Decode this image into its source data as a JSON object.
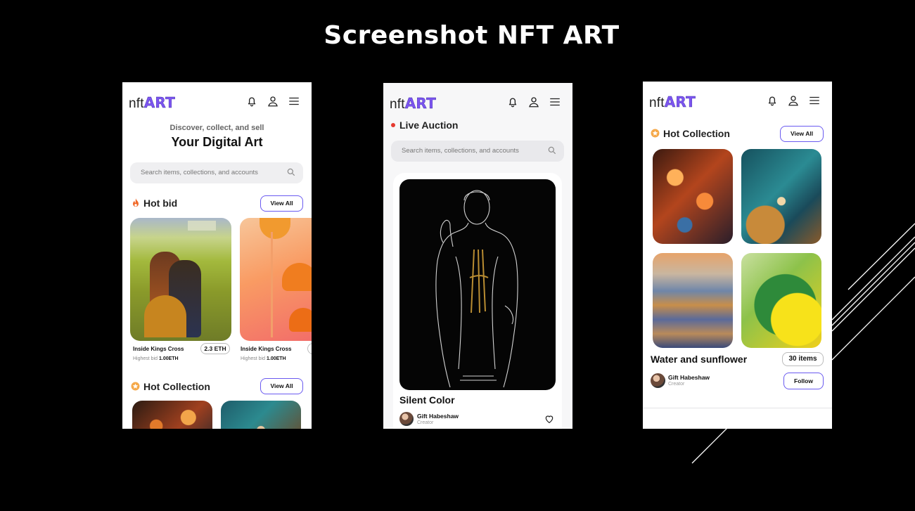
{
  "slide": {
    "title": "Screenshot NFT ART"
  },
  "brand": {
    "logo_prefix": "nft",
    "logo_accent": "ART",
    "accent_color": "#7d55f0",
    "outline_color": "#6a5af0"
  },
  "icons": {
    "bell": "bell-icon",
    "user": "user-icon",
    "menu": "menu-icon",
    "search": "search-icon",
    "fire": "fire-icon",
    "star": "star-badge-icon",
    "heart": "heart-icon"
  },
  "home": {
    "eyebrow": "Discover, collect, and sell",
    "title": "Your Digital Art",
    "search_placeholder": "Search items, collections, and accounts",
    "hot_bid": {
      "title": "Hot bid",
      "view_all": "View All",
      "cards": [
        {
          "name": "Inside Kings Cross",
          "price": "2.3 ETH",
          "bid_label": "Highest bid",
          "bid_value": "1.00ETH"
        },
        {
          "name": "Inside Kings Cross",
          "bid_label": "Highest bid",
          "bid_value": "1.00ETH"
        }
      ]
    },
    "hot_collection": {
      "title": "Hot Collection",
      "view_all": "View All"
    }
  },
  "auction": {
    "title": "Live Auction",
    "search_placeholder": "Search items, collections, and accounts",
    "item": {
      "name": "Silent Color",
      "creator": "Gift Habeshaw",
      "creator_role": "Creator"
    }
  },
  "collection": {
    "title": "Hot Collection",
    "view_all": "View All",
    "name": "Water and sunflower",
    "count": "30 items",
    "creator": "Gift Habeshaw",
    "creator_role": "Creator",
    "follow": "Follow"
  }
}
